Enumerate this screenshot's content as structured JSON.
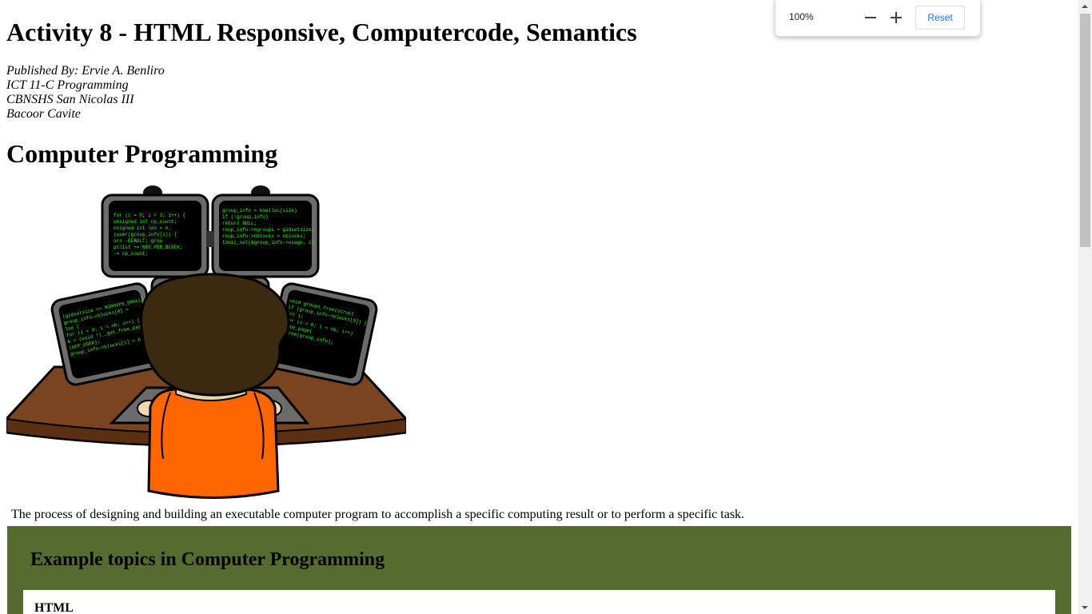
{
  "page": {
    "title": "Activity 8 - HTML Responsive, Computercode, Semantics",
    "byline": [
      "Published By: Ervie A. Benliro",
      "ICT 11-C Programming",
      "CBNSHS San Nicolas III",
      "Bacoor Cavite"
    ],
    "section_heading": "Computer Programming",
    "description": "The process of designing and building an executable computer program to accomplish a specific computing result or to perform a specific task.",
    "topics": {
      "heading": "Example topics in Computer Programming",
      "first_item": "HTML",
      "background_color": "#556b2f"
    }
  },
  "zoom_popup": {
    "level": "100%",
    "minus_icon": "minus-icon",
    "plus_icon": "plus-icon",
    "reset_label": "Reset"
  },
  "colors": {
    "desk": "#7a4420",
    "shirt": "#ff6600",
    "hair": "#3b2a10",
    "code_text": "#39ff14"
  }
}
